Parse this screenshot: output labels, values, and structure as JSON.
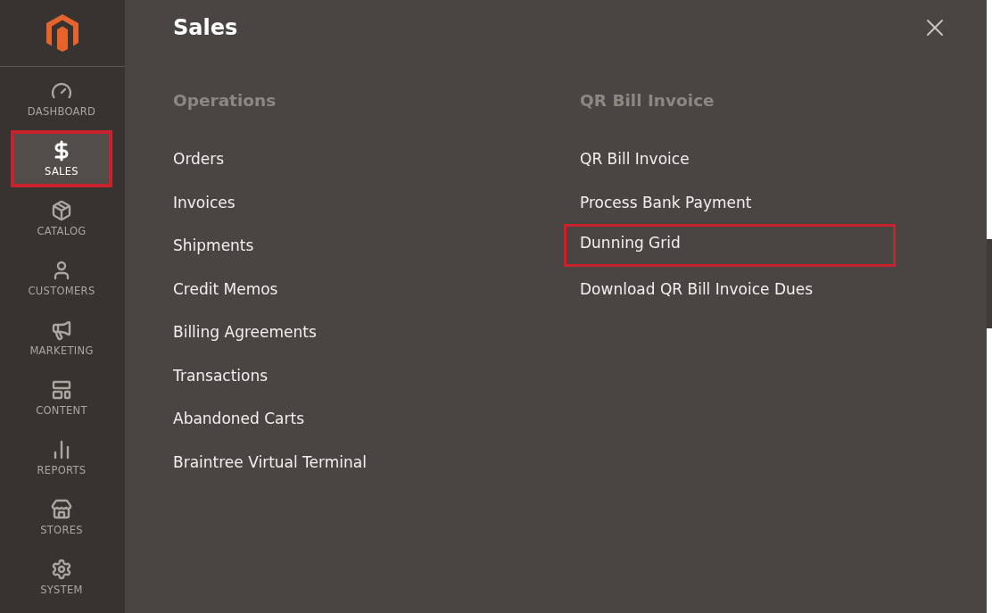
{
  "sidebar": {
    "items": [
      {
        "label": "DASHBOARD",
        "selected": false,
        "highlighted": false
      },
      {
        "label": "SALES",
        "selected": true,
        "highlighted": true
      },
      {
        "label": "CATALOG",
        "selected": false,
        "highlighted": false
      },
      {
        "label": "CUSTOMERS",
        "selected": false,
        "highlighted": false
      },
      {
        "label": "MARKETING",
        "selected": false,
        "highlighted": false
      },
      {
        "label": "CONTENT",
        "selected": false,
        "highlighted": false
      },
      {
        "label": "REPORTS",
        "selected": false,
        "highlighted": false
      },
      {
        "label": "STORES",
        "selected": false,
        "highlighted": false
      },
      {
        "label": "SYSTEM",
        "selected": false,
        "highlighted": false
      }
    ]
  },
  "panel": {
    "title": "Sales",
    "columns": [
      {
        "heading": "Operations",
        "links": [
          {
            "label": "Orders",
            "highlighted": false
          },
          {
            "label": "Invoices",
            "highlighted": false
          },
          {
            "label": "Shipments",
            "highlighted": false
          },
          {
            "label": "Credit Memos",
            "highlighted": false
          },
          {
            "label": "Billing Agreements",
            "highlighted": false
          },
          {
            "label": "Transactions",
            "highlighted": false
          },
          {
            "label": "Abandoned Carts",
            "highlighted": false
          },
          {
            "label": "Braintree Virtual Terminal",
            "highlighted": false
          }
        ]
      },
      {
        "heading": "QR Bill Invoice",
        "links": [
          {
            "label": "QR Bill Invoice",
            "highlighted": false
          },
          {
            "label": "Process Bank Payment",
            "highlighted": false
          },
          {
            "label": "Dunning Grid",
            "highlighted": true
          },
          {
            "label": "Download QR Bill Invoice Dues",
            "highlighted": false
          }
        ]
      }
    ]
  }
}
